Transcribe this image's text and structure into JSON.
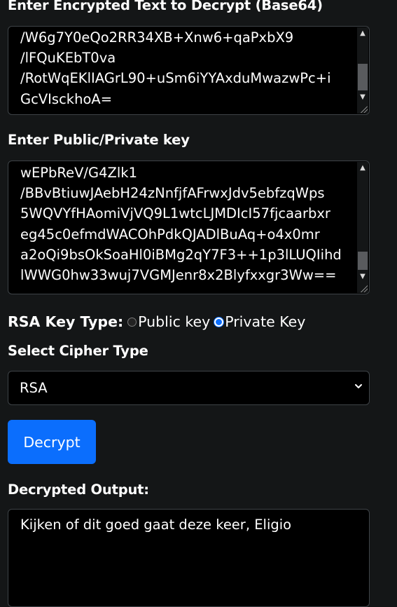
{
  "encrypted": {
    "label": "Enter Encrypted Text to Decrypt (Base64)",
    "text": "/W6g7Y0eQo2RR34XB+Xnw6+qaPxbX9\n/lFQuKEbT0va\n/RotWqEKlIAGrL90+uSm6iYYAxduMwazwPc+i\nGcVIsckhoA="
  },
  "key": {
    "label": "Enter Public/Private key",
    "text": "wEPbReV/G4Zlk1\n/BBvBtiuwJAebH24zNnfjfAFrwxJdv5ebfzqWps\n5WQVYfHAomiVjVQ9L1wtcLJMDIcI57fjcaarbxr\neg45c0efmdWACOhPdkQJADlBuAq+o4x0mr\na2oQi9bsOkSoaHl0iBMg2qY7F3++1p3lLUQIihd\nlWWG0hw33wuj7VGMJenr8x2Blyfxxgr3Ww=="
  },
  "rsa_key_type": {
    "label": "RSA Key Type:",
    "options": [
      {
        "label": "Public key",
        "selected": false
      },
      {
        "label": "Private Key",
        "selected": true
      }
    ]
  },
  "cipher": {
    "label": "Select Cipher Type",
    "selected": "RSA"
  },
  "decrypt_button": {
    "label": "Decrypt"
  },
  "output": {
    "label": "Decrypted Output:",
    "text": "Kijken of dit goed gaat deze keer, Eligio"
  },
  "colors": {
    "background": "#141617",
    "field_background": "#000000",
    "accent": "#0b6efd",
    "border": "#3e4347"
  },
  "icons": [
    "scroll-up-arrow-icon",
    "scroll-down-arrow-icon",
    "chevron-down-icon",
    "resize-grip-icon"
  ]
}
